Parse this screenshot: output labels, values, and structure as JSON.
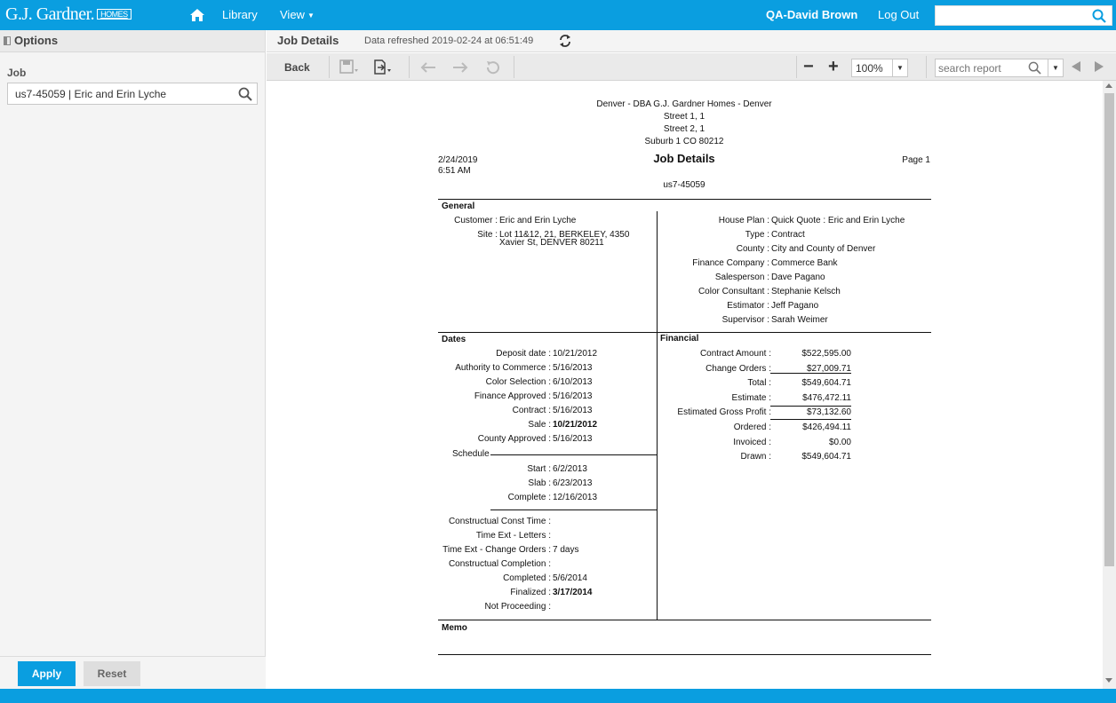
{
  "app": {
    "logo_text": "G.J. Gardner.",
    "logo_badge": "HOMES",
    "nav": {
      "library": "Library",
      "view": "View"
    },
    "user": "QA-David Brown",
    "logout": "Log Out",
    "search_placeholder": ""
  },
  "left_panel": {
    "title": "Options",
    "job_label": "Job",
    "job_value": "us7-45059 | Eric and Erin Lyche",
    "apply": "Apply",
    "reset": "Reset"
  },
  "report_header": {
    "title": "Job Details",
    "refreshed": "Data refreshed 2019-02-24 at 06:51:49"
  },
  "toolbar": {
    "back": "Back",
    "zoom": "100%",
    "search_placeholder": "search report"
  },
  "report": {
    "company": "Denver - DBA G.J. Gardner Homes - Denver",
    "street1": "Street 1, 1",
    "street2": "Street 2, 1",
    "suburb": "Suburb 1 CO 80212",
    "date": "2/24/2019",
    "time": "6:51 AM",
    "title": "Job Details",
    "page": "Page 1",
    "job_no": "us7-45059",
    "general": {
      "heading": "General",
      "customer_label": "Customer :",
      "customer": "Eric and Erin Lyche",
      "site_label": "Site :",
      "site_line1": "Lot 11&12, 21, BERKELEY, 4350",
      "site_line2": "Xavier St, DENVER 80211",
      "right": [
        {
          "label": "House Plan :",
          "value": "Quick Quote : Eric and Erin Lyche"
        },
        {
          "label": "Type :",
          "value": "Contract"
        },
        {
          "label": "County :",
          "value": "City and County of Denver"
        },
        {
          "label": "Finance Company :",
          "value": "Commerce Bank"
        },
        {
          "label": "Salesperson :",
          "value": "Dave Pagano"
        },
        {
          "label": "Color Consultant :",
          "value": "Stephanie Kelsch"
        },
        {
          "label": "Estimator :",
          "value": "Jeff Pagano"
        },
        {
          "label": "Supervisor :",
          "value": "Sarah Weimer"
        }
      ]
    },
    "dates": {
      "heading": "Dates",
      "rows": [
        {
          "label": "Deposit date :",
          "value": "10/21/2012"
        },
        {
          "label": "Authority to Commerce :",
          "value": "5/16/2013"
        },
        {
          "label": "Color Selection :",
          "value": "6/10/2013"
        },
        {
          "label": "Finance Approved :",
          "value": "5/16/2013"
        },
        {
          "label": "Contract :",
          "value": "5/16/2013"
        },
        {
          "label": "Sale :",
          "value": "10/21/2012"
        },
        {
          "label": "County Approved :",
          "value": "5/16/2013"
        }
      ],
      "schedule_label": "Schedule",
      "schedule": [
        {
          "label": "Start :",
          "value": "6/2/2013"
        },
        {
          "label": "Slab :",
          "value": "6/23/2013"
        },
        {
          "label": "Complete :",
          "value": "12/16/2013"
        }
      ],
      "rows2": [
        {
          "label": "Constructual Const Time :",
          "value": ""
        },
        {
          "label": "Time Ext - Letters :",
          "value": ""
        },
        {
          "label": "Time Ext - Change Orders :",
          "value": "7 days"
        },
        {
          "label": "Constructual Completion :",
          "value": ""
        },
        {
          "label": "Completed :",
          "value": "5/6/2014"
        },
        {
          "label": "Finalized :",
          "value": "3/17/2014"
        },
        {
          "label": "Not Proceeding :",
          "value": ""
        }
      ]
    },
    "financial": {
      "heading": "Financial",
      "rows": [
        {
          "label": "Contract Amount :",
          "value": "$522,595.00"
        },
        {
          "label": "Change Orders :",
          "value": "$27,009.71"
        },
        {
          "label": "Total :",
          "value": "$549,604.71"
        },
        {
          "label": "Estimate :",
          "value": "$476,472.11"
        },
        {
          "label": "Estimated Gross Profit :",
          "value": "$73,132.60"
        },
        {
          "label": "Ordered :",
          "value": "$426,494.11"
        },
        {
          "label": "Invoiced :",
          "value": "$0.00"
        },
        {
          "label": "Drawn :",
          "value": "$549,604.71"
        }
      ]
    },
    "memo": {
      "heading": "Memo"
    }
  }
}
